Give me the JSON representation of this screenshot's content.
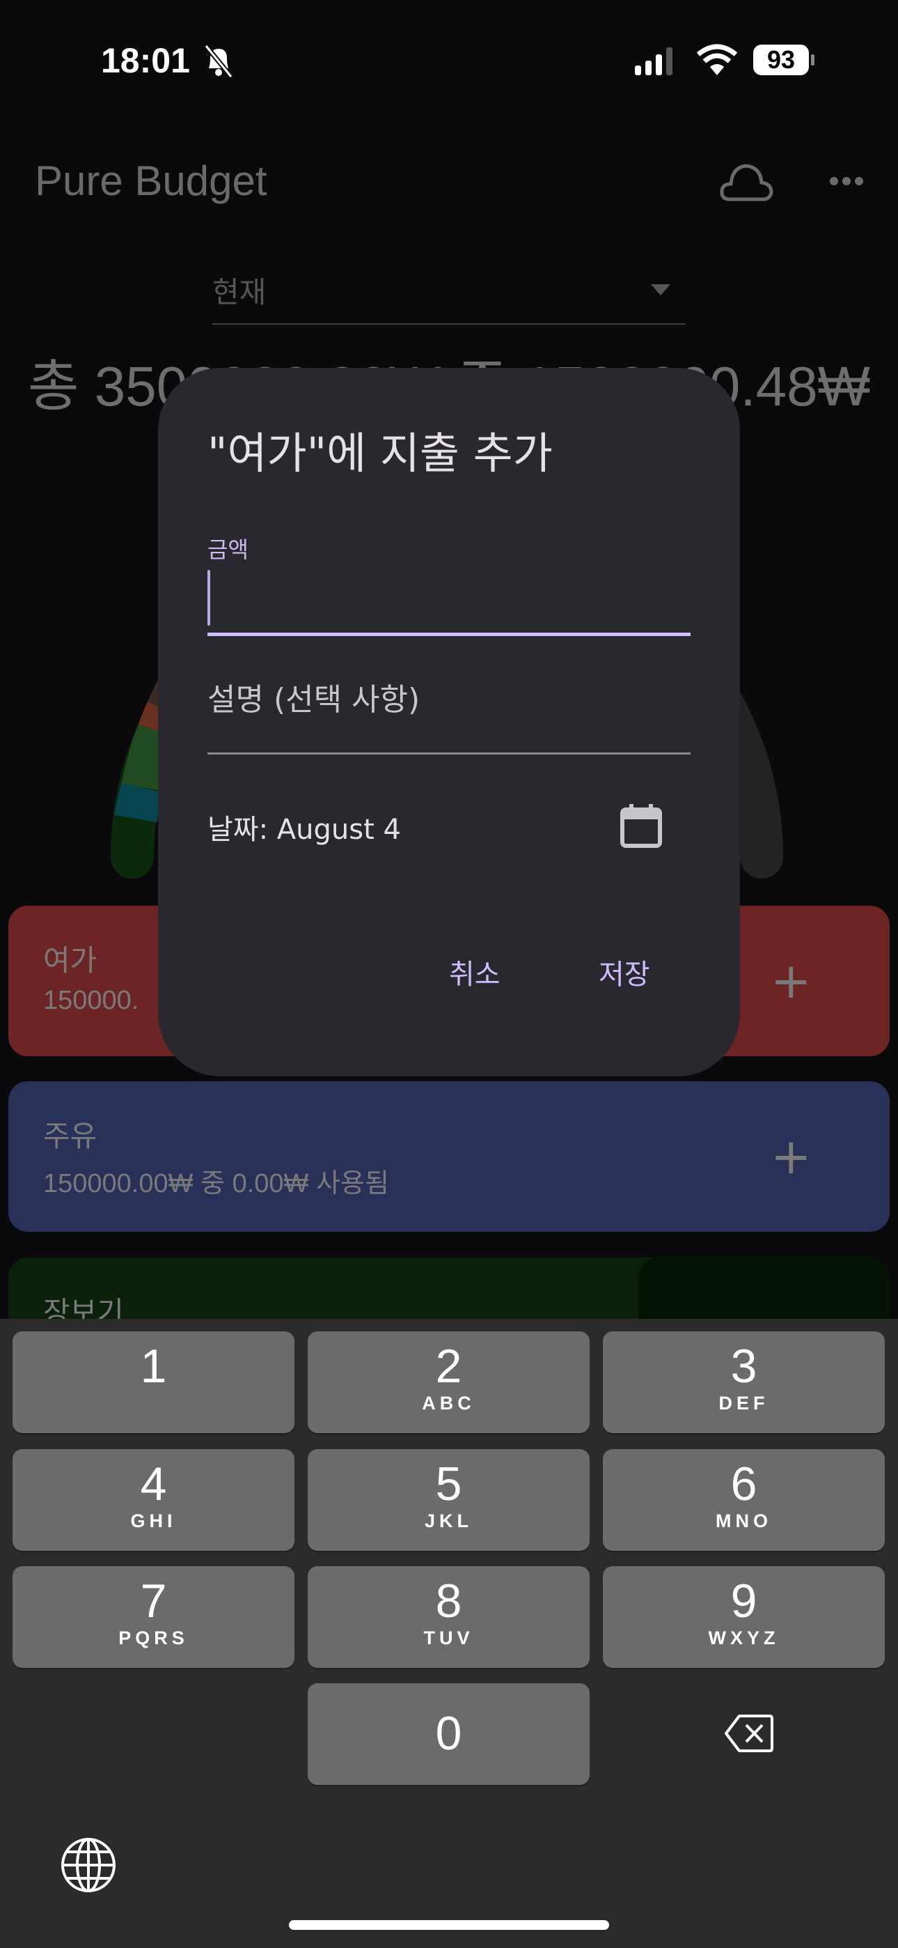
{
  "status_bar": {
    "time": "18:01",
    "battery": "93",
    "icons": [
      "bell-slash-icon",
      "signal-icon",
      "wifi-icon",
      "battery-icon"
    ]
  },
  "app": {
    "title": "Pure Budget",
    "icons": [
      "cloud-icon",
      "more-icon"
    ]
  },
  "period_select": {
    "value": "현재"
  },
  "summary": {
    "total_text": "총 3500000.00₩ 중 1500000.48₩"
  },
  "categories": [
    {
      "name": "여가",
      "sub": "150000.",
      "color": "#6c2524"
    },
    {
      "name": "주유",
      "sub": "150000.00₩ 중 0.00₩ 사용됨",
      "color": "#293158"
    },
    {
      "name": "장보기",
      "color": "#0a200b"
    }
  ],
  "dialog": {
    "title": "\"여가\"에 지출 추가",
    "amount_label": "금액",
    "amount_value": "",
    "description_placeholder": "설명 (선택 사항)",
    "date_text": "날짜: August 4",
    "cancel": "취소",
    "save": "저장"
  },
  "keyboard": {
    "keys": [
      {
        "d": "1",
        "l": ""
      },
      {
        "d": "2",
        "l": "ABC"
      },
      {
        "d": "3",
        "l": "DEF"
      },
      {
        "d": "4",
        "l": "GHI"
      },
      {
        "d": "5",
        "l": "JKL"
      },
      {
        "d": "6",
        "l": "MNO"
      },
      {
        "d": "7",
        "l": "PQRS"
      },
      {
        "d": "8",
        "l": "TUV"
      },
      {
        "d": "9",
        "l": "WXYZ"
      },
      {
        "d": "0",
        "l": ""
      }
    ]
  },
  "colors": {
    "accent": "#cfbcff",
    "dialog_bg": "#29282e"
  }
}
